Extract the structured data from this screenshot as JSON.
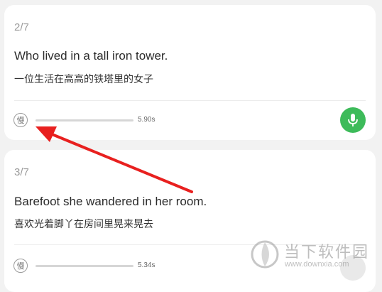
{
  "cards": [
    {
      "counter": "2/7",
      "english": "Who lived in a tall iron tower.",
      "chinese": "一位生活在高高的铁塔里的女子",
      "slow_label": "慢",
      "duration": "5.90s",
      "mic_icon": "microphone-icon"
    },
    {
      "counter": "3/7",
      "english": "Barefoot she wandered in her room.",
      "chinese": "喜欢光着脚丫在房间里晃来晃去",
      "slow_label": "慢",
      "duration": "5.34s",
      "mic_icon": "microphone-icon"
    }
  ],
  "annotation": {
    "arrow_color": "#e8201f"
  },
  "watermark": {
    "text": "当下软件园",
    "url": "www.downxia.com"
  },
  "colors": {
    "accent_green": "#3dbb5a",
    "background": "#f2f2f2"
  }
}
